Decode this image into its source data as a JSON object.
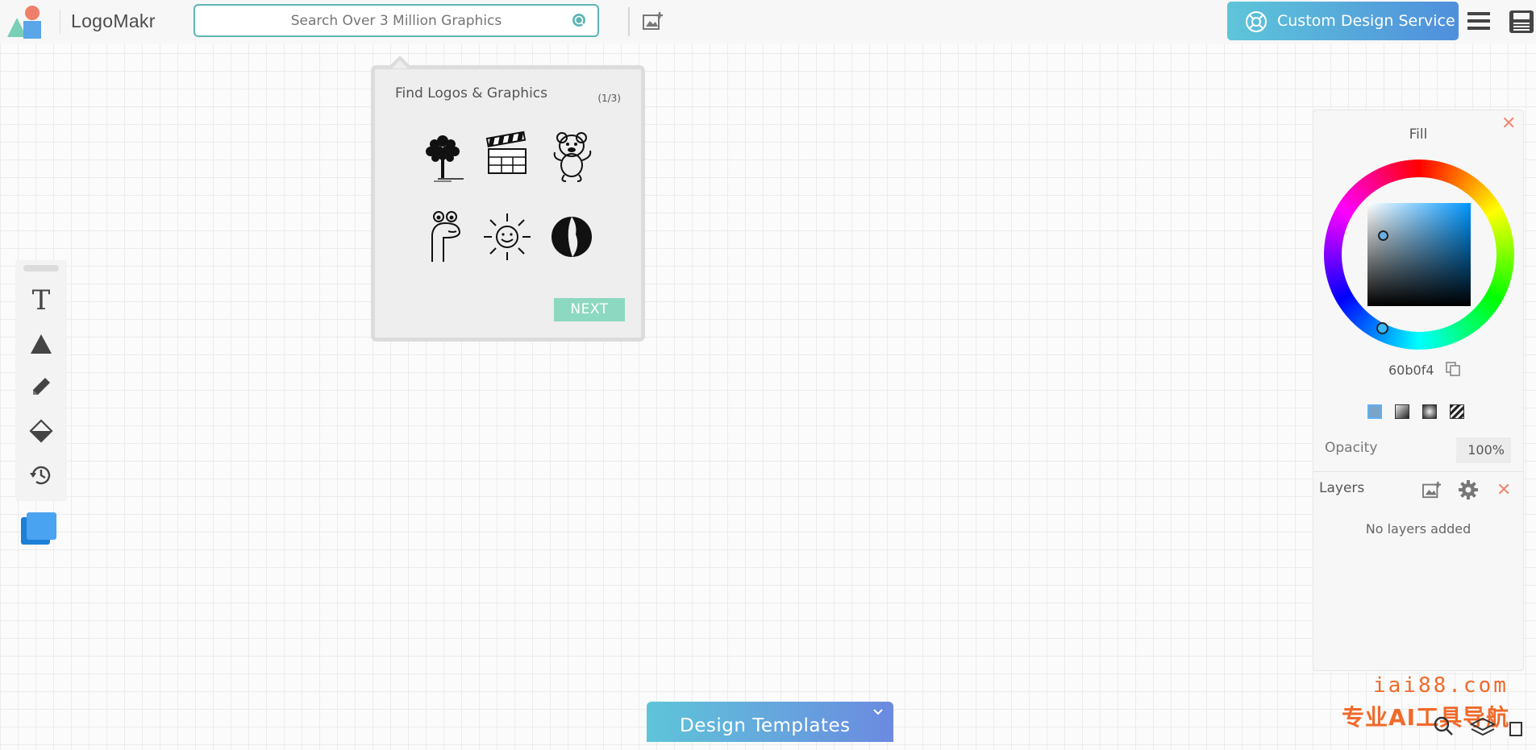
{
  "header": {
    "brand": "LogoMakr",
    "search": {
      "placeholder": "Search Over 3 Million Graphics",
      "value": ""
    },
    "custom_design_label": "Custom Design Service"
  },
  "popover": {
    "title": "Find Logos & Graphics",
    "counter": "(1/3)",
    "graphics": [
      "tree-graphic",
      "clapperboard-graphic",
      "teddy-bear-graphic",
      "cartoon-creature-graphic",
      "smiling-sun-graphic",
      "dark-circle-graphic"
    ],
    "next_label": "NEXT"
  },
  "toolbar": {
    "tools": [
      "text-tool",
      "shape-tool",
      "pencil-tool",
      "fill-tool",
      "history-tool"
    ],
    "swatch_color": "#1e7fd6"
  },
  "fill_panel": {
    "title": "Fill",
    "hex": "60b0f4",
    "opacity_label": "Opacity",
    "opacity_value": "100%"
  },
  "layers_panel": {
    "title": "Layers",
    "empty_text": "No layers added"
  },
  "footer": {
    "templates_label": "Design Templates"
  },
  "watermark": {
    "line1": "iai88.com",
    "line2": "专业AI工具导航"
  },
  "colors": {
    "accent_teal": "#5cb6b4",
    "next_button": "#8dd8c0",
    "close_red": "#f08a73",
    "watermark": "#f06a2a"
  }
}
